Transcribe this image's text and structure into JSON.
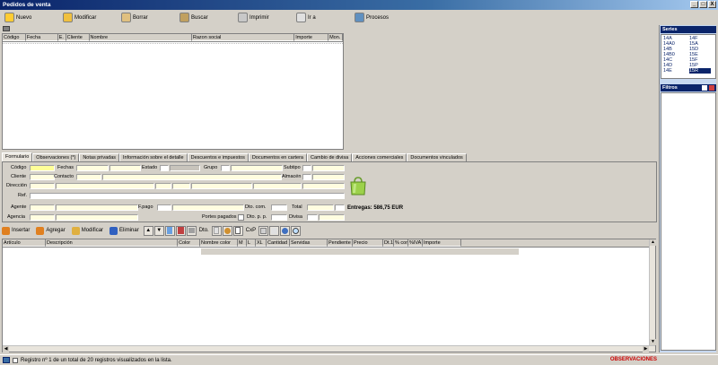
{
  "window": {
    "title": "Pedidos de venta",
    "buttons": [
      "_",
      "□",
      "X"
    ]
  },
  "toolbar": [
    {
      "label": "Nuevo",
      "icon": "new-doc-icon",
      "color": "#ffcc33"
    },
    {
      "label": "Modificar",
      "icon": "edit-icon",
      "color": "#f0c040"
    },
    {
      "label": "Borrar",
      "icon": "delete-icon",
      "color": "#e0c080"
    },
    {
      "label": "Buscar",
      "icon": "search-icon",
      "color": "#c0a060"
    },
    {
      "label": "Imprimir",
      "icon": "print-icon",
      "color": "#c8c8c8"
    },
    {
      "label": "Ir a",
      "icon": "goto-icon",
      "color": "#e0e0e0"
    },
    {
      "label": "Procesos",
      "icon": "process-icon",
      "color": "#6090c0"
    }
  ],
  "grid1": {
    "columns": [
      "Código",
      "Fecha",
      "E.",
      "Cliente",
      "Nombre",
      "Razon social",
      "Importe",
      "Mon."
    ]
  },
  "tabs": [
    "Formulario",
    "Observaciones (*)",
    "Notas privadas",
    "Información sobre el detalle",
    "Descuentos e impuestos",
    "Documentos en cartera",
    "Cambio de divisa",
    "Acciones comerciales",
    "Documentos vinculados"
  ],
  "form": {
    "codigo": "Código",
    "fechas": "Fechas",
    "estado": "Estado",
    "grupo": "Grupo",
    "subtipo": "Subtipo",
    "cliente": "Cliente",
    "contacto": "Contacto",
    "almacen": "Almacén",
    "direccion": "Dirección",
    "ref": "Ref.",
    "agente": "Agente",
    "fpago": "F.pago",
    "dtocom": "Dto. com.",
    "total": "Total",
    "agencia": "Agencia",
    "portes": "Portes pagados",
    "dtopp": "Dto. p. p.",
    "divisa": "Divisa"
  },
  "entregas": "Entregas: 586,75 EUR",
  "toolbar2": {
    "insertar": "Insertar",
    "agregar": "Agregar",
    "modificar": "Modificar",
    "eliminar": "Eliminar",
    "dto": "Dto.",
    "cxp": "CxP"
  },
  "grid2": {
    "columns": [
      "Artículo",
      "Descripción",
      "Color",
      "Nombre color",
      "M",
      "L",
      "XL",
      "Cantidad",
      "Servidas",
      "Pendiente",
      "Precio",
      "Dt.1",
      "% com.",
      "%IVA",
      "Importe"
    ]
  },
  "series": {
    "title": "Series",
    "col1": [
      "14A",
      "14A0",
      "14B",
      "14B0",
      "14C",
      "14D",
      "14E"
    ],
    "col2": [
      "14F",
      "15A",
      "15D",
      "15E",
      "15F",
      "15P",
      "15R"
    ],
    "selected": "15R"
  },
  "filtros": {
    "title": "Filtros"
  },
  "status": {
    "text": "Registro nº 1 de un total de 20 registros visualizados en la lista.",
    "observaciones": "OBSERVACIONES"
  }
}
